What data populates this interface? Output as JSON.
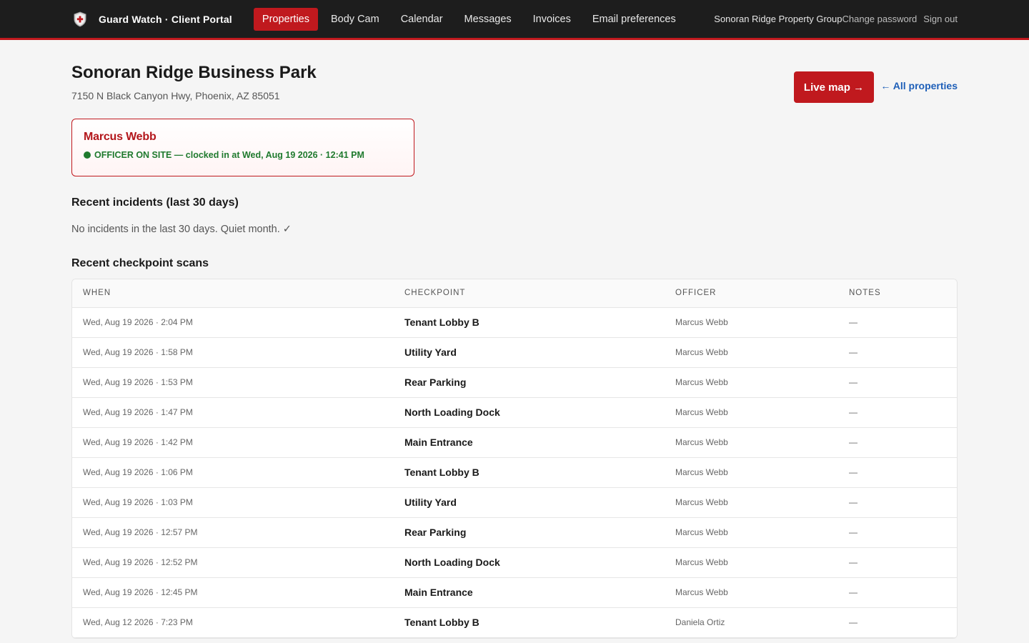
{
  "app": {
    "brand": "Guard Watch · Client Portal",
    "nav": [
      "Properties",
      "Body Cam",
      "Calendar",
      "Messages",
      "Invoices",
      "Email preferences"
    ],
    "active_nav": "Properties",
    "org_name": "Sonoran Ridge Property Group",
    "change_password": "Change password",
    "sign_out": "Sign out",
    "accent_color": "#c0191e"
  },
  "property": {
    "name": "Sonoran Ridge Business Park",
    "address": "7150 N Black Canyon Hwy, Phoenix, AZ 85051",
    "live_map_label": "Live map →",
    "all_properties_label": "← All properties"
  },
  "officer": {
    "name": "Marcus Webb",
    "status": "OFFICER ON SITE — clocked in at Wed, Aug 19 2026 · 12:41 PM",
    "status_color": "#1f7a2e"
  },
  "incidents": {
    "title": "Recent incidents (last 30 days)",
    "empty_message": "No incidents in the last 30 days. Quiet month. ✓"
  },
  "scans": {
    "title": "Recent checkpoint scans",
    "columns": [
      "WHEN",
      "CHECKPOINT",
      "OFFICER",
      "NOTES"
    ],
    "rows": [
      {
        "when": "Wed, Aug 19 2026 · 2:04 PM",
        "checkpoint": "Tenant Lobby B",
        "officer": "Marcus Webb",
        "notes": "—"
      },
      {
        "when": "Wed, Aug 19 2026 · 1:58 PM",
        "checkpoint": "Utility Yard",
        "officer": "Marcus Webb",
        "notes": "—"
      },
      {
        "when": "Wed, Aug 19 2026 · 1:53 PM",
        "checkpoint": "Rear Parking",
        "officer": "Marcus Webb",
        "notes": "—"
      },
      {
        "when": "Wed, Aug 19 2026 · 1:47 PM",
        "checkpoint": "North Loading Dock",
        "officer": "Marcus Webb",
        "notes": "—"
      },
      {
        "when": "Wed, Aug 19 2026 · 1:42 PM",
        "checkpoint": "Main Entrance",
        "officer": "Marcus Webb",
        "notes": "—"
      },
      {
        "when": "Wed, Aug 19 2026 · 1:06 PM",
        "checkpoint": "Tenant Lobby B",
        "officer": "Marcus Webb",
        "notes": "—"
      },
      {
        "when": "Wed, Aug 19 2026 · 1:03 PM",
        "checkpoint": "Utility Yard",
        "officer": "Marcus Webb",
        "notes": "—"
      },
      {
        "when": "Wed, Aug 19 2026 · 12:57 PM",
        "checkpoint": "Rear Parking",
        "officer": "Marcus Webb",
        "notes": "—"
      },
      {
        "when": "Wed, Aug 19 2026 · 12:52 PM",
        "checkpoint": "North Loading Dock",
        "officer": "Marcus Webb",
        "notes": "—"
      },
      {
        "when": "Wed, Aug 19 2026 · 12:45 PM",
        "checkpoint": "Main Entrance",
        "officer": "Marcus Webb",
        "notes": "—"
      },
      {
        "when": "Wed, Aug 12 2026 · 7:23 PM",
        "checkpoint": "Tenant Lobby B",
        "officer": "Daniela Ortiz",
        "notes": "—"
      }
    ]
  }
}
